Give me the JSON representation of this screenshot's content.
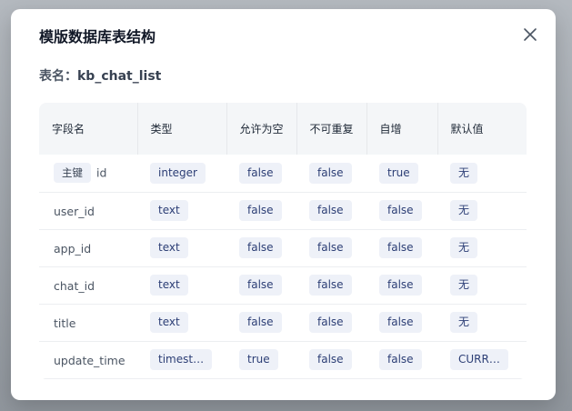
{
  "modal": {
    "title": "模版数据库表结构",
    "table_name_label": "表名：",
    "table_name": "kb_chat_list"
  },
  "columns": [
    "字段名",
    "类型",
    "允许为空",
    "不可重复",
    "自增",
    "默认值"
  ],
  "primary_key_label": "主键",
  "rows": [
    {
      "name": "id",
      "type": "integer",
      "nullable": "false",
      "unique": "false",
      "auto_inc": "true",
      "default": "无"
    },
    {
      "name": "user_id",
      "type": "text",
      "nullable": "false",
      "unique": "false",
      "auto_inc": "false",
      "default": "无"
    },
    {
      "name": "app_id",
      "type": "text",
      "nullable": "false",
      "unique": "false",
      "auto_inc": "false",
      "default": "无"
    },
    {
      "name": "chat_id",
      "type": "text",
      "nullable": "false",
      "unique": "false",
      "auto_inc": "false",
      "default": "无"
    },
    {
      "name": "title",
      "type": "text",
      "nullable": "false",
      "unique": "false",
      "auto_inc": "false",
      "default": "无"
    },
    {
      "name": "update_time",
      "type": "timest…",
      "nullable": "true",
      "unique": "false",
      "auto_inc": "false",
      "default": "CURR…"
    }
  ],
  "icons": {
    "close": "close-icon"
  }
}
